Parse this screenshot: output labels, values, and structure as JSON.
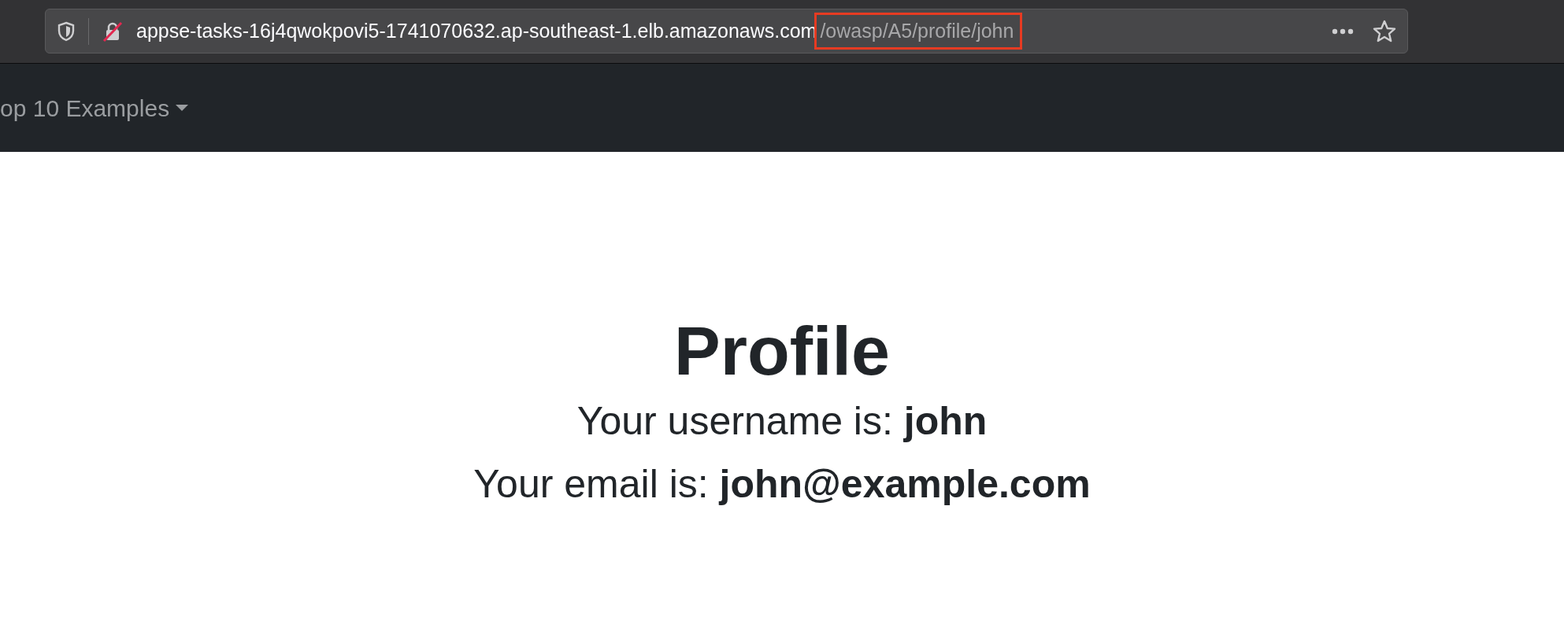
{
  "address_bar": {
    "host": "appse-tasks-16j4qwokpovi5-1741070632.ap-southeast-1.elb.amazonaws.com",
    "path": "/owasp/A5/profile/john",
    "path_highlighted": true
  },
  "navbar": {
    "dropdown": {
      "label": "op 10 Examples"
    }
  },
  "profile": {
    "title": "Profile",
    "lines": [
      "Your username is: **john**",
      "Your email is: **john@example.com**"
    ]
  }
}
